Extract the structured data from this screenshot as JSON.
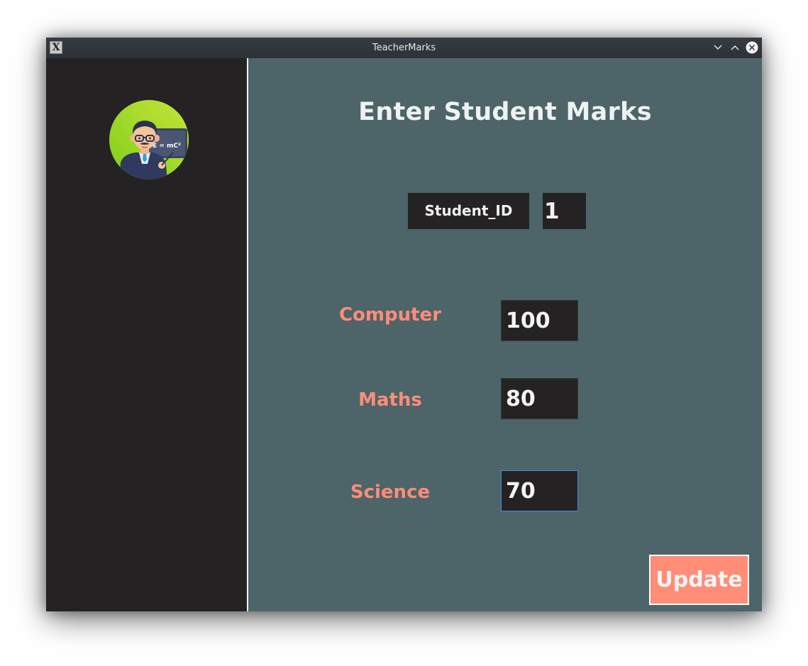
{
  "window": {
    "title": "TeacherMarks",
    "app_icon_glyph": "X"
  },
  "titlebar_buttons": {
    "minimize_icon": "chevron-down-icon",
    "maximize_icon": "chevron-up-icon",
    "close_icon": "close-icon"
  },
  "sidebar": {
    "avatar_icon": "teacher-avatar-icon",
    "avatar_board_text": "E = mC²"
  },
  "main": {
    "heading": "Enter Student Marks",
    "student_id_label": "Student_ID",
    "student_id_value": "1",
    "subjects": [
      {
        "label": "Computer",
        "value": "100"
      },
      {
        "label": "Maths",
        "value": "80"
      },
      {
        "label": "Science",
        "value": "70"
      }
    ],
    "update_label": "Update"
  },
  "colors": {
    "sidebar_bg": "#252223",
    "main_bg": "#4d6469",
    "accent": "#ff8d78",
    "focus_border": "#3d8fd8"
  }
}
